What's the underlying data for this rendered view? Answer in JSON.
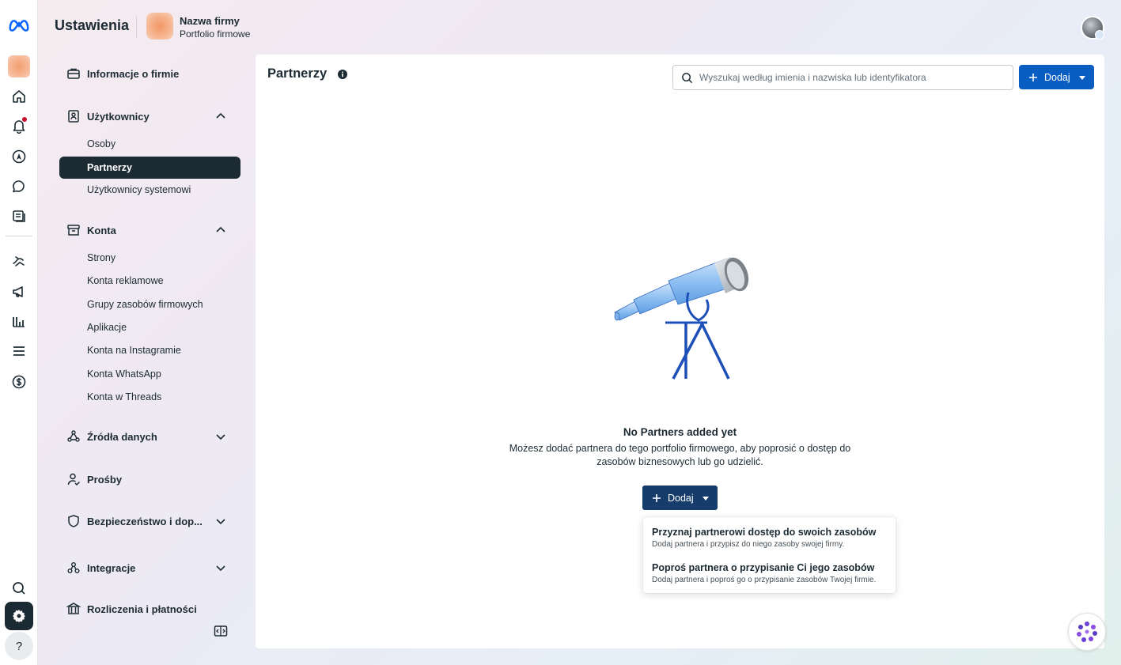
{
  "header": {
    "app_title": "Ustawienia",
    "business_name": "Nazwa firmy",
    "business_subtitle": "Portfolio firmowe"
  },
  "rail": {
    "icons": [
      "meta-logo-icon",
      "business-avatar",
      "home-icon",
      "notifications-icon",
      "compass-icon",
      "chat-icon",
      "pages-icon",
      "handshake-icon",
      "megaphone-icon",
      "analytics-icon",
      "menu-icon",
      "billing-icon",
      "search-icon",
      "settings-icon",
      "help-icon"
    ],
    "help_label": "?"
  },
  "sidebar": {
    "company_info": "Informacje o firmie",
    "users": {
      "label": "Użytkownicy",
      "items": [
        "Osoby",
        "Partnerzy",
        "Użytkownicy systemowi"
      ]
    },
    "accounts": {
      "label": "Konta",
      "items": [
        "Strony",
        "Konta reklamowe",
        "Grupy zasobów firmowych",
        "Aplikacje",
        "Konta na Instagramie",
        "Konta WhatsApp",
        "Konta w Threads"
      ]
    },
    "data_sources": "Źródła danych",
    "requests": "Prośby",
    "security": "Bezpieczeństwo i dop...",
    "integrations": "Integracje",
    "billing": "Rozliczenia i płatności"
  },
  "main": {
    "title": "Partnerzy",
    "search_placeholder": "Wyszukaj według imienia i nazwiska lub identyfikatora",
    "add_label": "Dodaj",
    "empty_title": "No Partners added yet",
    "empty_desc": "Możesz dodać partnera do tego portfolio firmowego, aby poprosić o dostęp do zasobów biznesowych lub go udzielić.",
    "empty_add_label": "Dodaj"
  },
  "dropdown": {
    "items": [
      {
        "title": "Przyznaj partnerowi dostęp do swoich zasobów",
        "desc": "Dodaj partnera i przypisz do niego zasoby swojej firmy."
      },
      {
        "title": "Poproś partnera o przypisanie Ci jego zasobów",
        "desc": "Dodaj partnera i poproś go o przypisanie zasobów Twojej firmie."
      }
    ]
  },
  "colors": {
    "primary": "#0a5ec2",
    "dark_button": "#163c6c",
    "active_nav": "#1c2b33",
    "notification_dot": "#c8102e"
  }
}
